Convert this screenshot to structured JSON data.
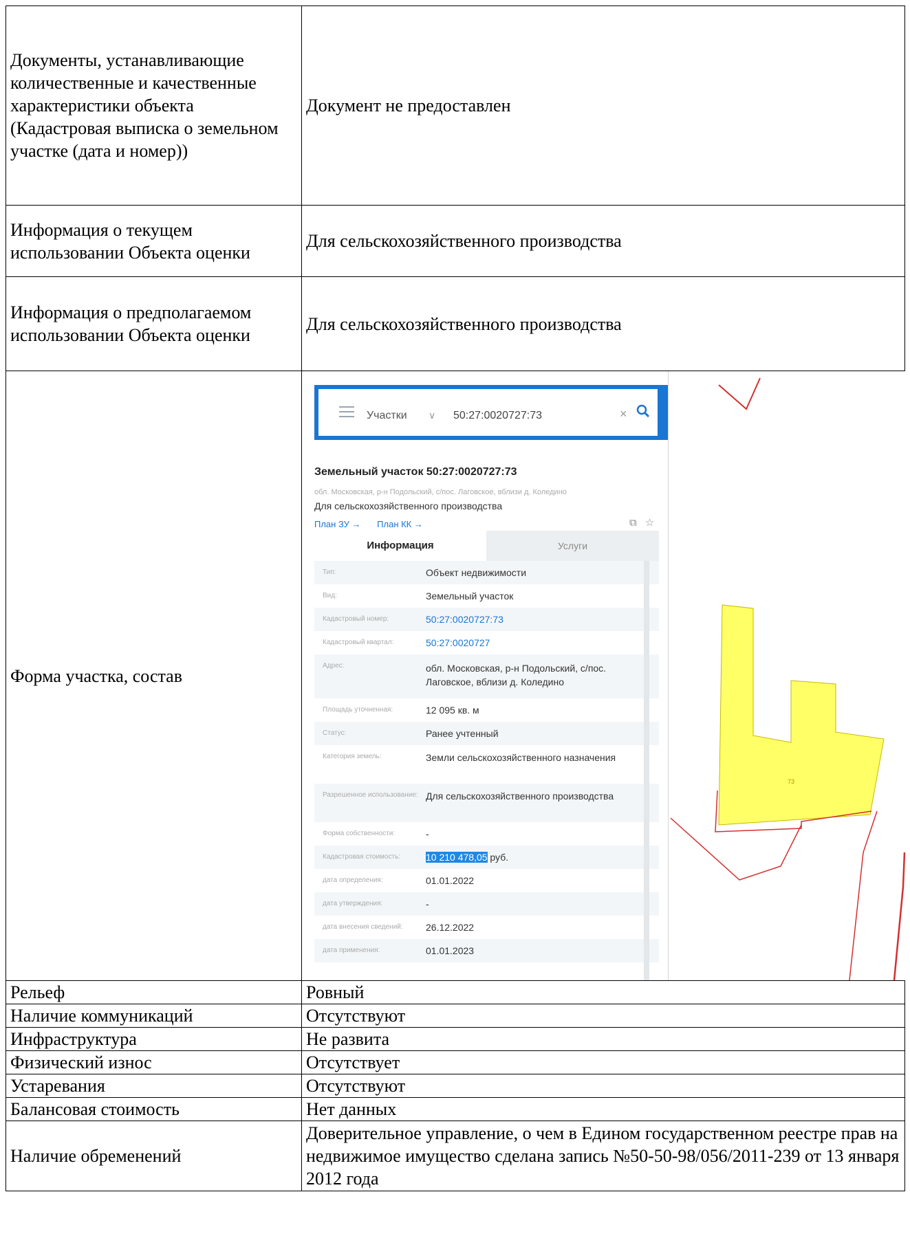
{
  "table": {
    "rows": [
      {
        "label": "Документы, устанавливающие количественные и качественные характеристики объекта (Кадастровая выписка о земельном участке (дата и номер))",
        "value": "Документ не предоставлен"
      },
      {
        "label": "Информация о текущем использовании Объекта оценки",
        "value": "Для сельскохозяйственного производства"
      },
      {
        "label": "Информация о предполагаемом использовании Объекта оценки",
        "value": "Для сельскохозяйственного производства"
      },
      {
        "label": "Форма участка, состав"
      },
      {
        "label": "Рельеф",
        "value": "Ровный"
      },
      {
        "label": "Наличие коммуникаций",
        "value": "Отсутствуют"
      },
      {
        "label": "Инфраструктура",
        "value": "Не развита"
      },
      {
        "label": "Физический износ",
        "value": "Отсутствует"
      },
      {
        "label": "Устаревания",
        "value": "Отсутствуют"
      },
      {
        "label": "Балансовая стоимость",
        "value": "Нет данных"
      },
      {
        "label": "Наличие обременений",
        "value": "Доверительное управление, о чем в Едином государственном реестре прав на недвижимое имущество сделана запись №50-50-98/056/2011-239 от 13 января 2012 года"
      }
    ]
  },
  "screenshot": {
    "search_category": "Участки",
    "search_value": "50:27:0020727:73",
    "title": "Земельный участок 50:27:0020727:73",
    "address_line": "обл. Московская, р-н Подольский, с/пос. Лаговское, вблизи д. Коледино",
    "use_line": "Для сельскохозяйственного производства",
    "link_plan_zu": "План ЗУ →",
    "link_plan_kk": "План КК →",
    "tab_info": "Информация",
    "tab_services": "Услуги",
    "map_label": "73",
    "fields": [
      {
        "label": "Тип:",
        "value": "Объект недвижимости"
      },
      {
        "label": "Вид:",
        "value": "Земельный участок"
      },
      {
        "label": "Кадастровый номер:",
        "value": "50:27:0020727:73"
      },
      {
        "label": "Кадастровый квартал:",
        "value": "50:27:0020727"
      },
      {
        "label": "Адрес:",
        "value": "обл. Московская, р-н Подольский, с/пос. Лаговское, вблизи д. Коледино"
      },
      {
        "label": "Площадь уточненная:",
        "value": "12 095 кв. м"
      },
      {
        "label": "Статус:",
        "value": "Ранее учтенный"
      },
      {
        "label": "Категория земель:",
        "value": "Земли сельскохозяйственного назначения"
      },
      {
        "label": "Разрешенное использование:",
        "value": "Для сельскохозяйственного производства"
      },
      {
        "label": "Форма собственности:",
        "value": "-"
      },
      {
        "label": "Кадастровая стоимость:",
        "value_highlight": "10 210 478,05",
        "value_rest": " руб."
      },
      {
        "label": "дата определения:",
        "value": "01.01.2022"
      },
      {
        "label": "дата утверждения:",
        "value": "-"
      },
      {
        "label": "дата внесения сведений:",
        "value": "26.12.2022"
      },
      {
        "label": "дата применения:",
        "value": "01.01.2023"
      }
    ],
    "colors": {
      "accent": "#1976d2",
      "parcel_fill": "#ffff66",
      "boundary": "#d32f2f"
    }
  }
}
